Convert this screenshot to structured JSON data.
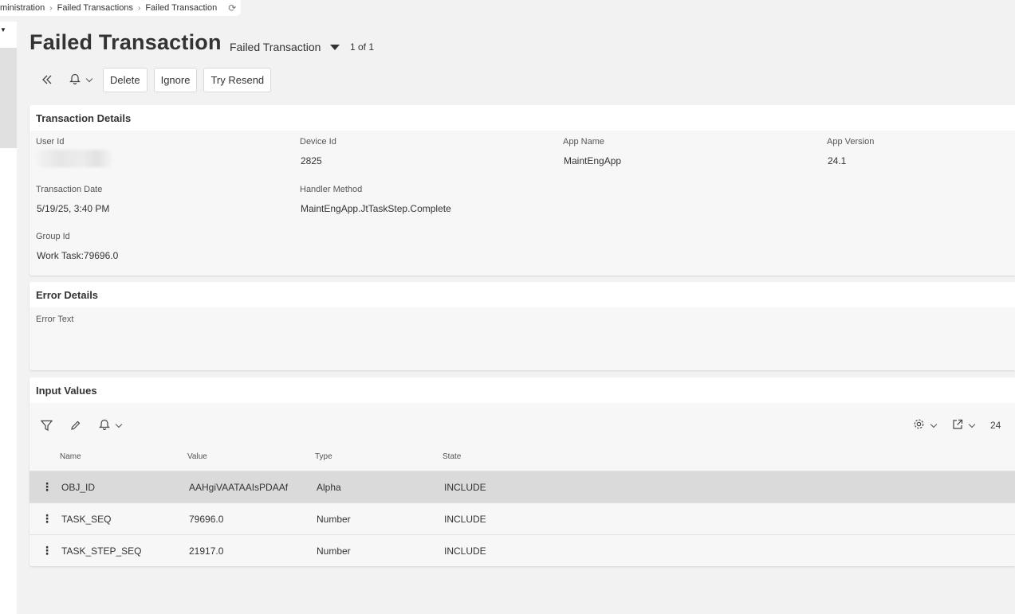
{
  "breadcrumb": {
    "items": [
      "ministration",
      "Failed Transactions",
      "Failed Transaction"
    ]
  },
  "header": {
    "title": "Failed Transaction",
    "record_selector": "Failed Transaction",
    "pager": "1 of 1"
  },
  "toolbar": {
    "delete_label": "Delete",
    "ignore_label": "Ignore",
    "resend_label": "Try Resend"
  },
  "transaction_details": {
    "title": "Transaction Details",
    "user_id_label": "User Id",
    "device_id_label": "Device Id",
    "device_id": "2825",
    "app_name_label": "App Name",
    "app_name": "MaintEngApp",
    "app_version_label": "App Version",
    "app_version": "24.1",
    "transaction_date_label": "Transaction Date",
    "transaction_date": "5/19/25, 3:40 PM",
    "handler_method_label": "Handler Method",
    "handler_method": "MaintEngApp.JtTaskStep.Complete",
    "group_id_label": "Group Id",
    "group_id": "Work Task:79696.0"
  },
  "error_details": {
    "title": "Error Details",
    "error_text_label": "Error Text",
    "error_text": ""
  },
  "input_values": {
    "title": "Input Values",
    "page_count_partial": "24",
    "columns": [
      "Name",
      "Value",
      "Type",
      "State"
    ],
    "rows": [
      {
        "name": "OBJ_ID",
        "value": "AAHgiVAATAAIsPDAAf",
        "type": "Alpha",
        "state": "INCLUDE"
      },
      {
        "name": "TASK_SEQ",
        "value": "79696.0",
        "type": "Number",
        "state": "INCLUDE"
      },
      {
        "name": "TASK_STEP_SEQ",
        "value": "21917.0",
        "type": "Number",
        "state": "INCLUDE"
      }
    ]
  },
  "icons": {
    "collapse": "double-chevron-left-icon",
    "bell": "bell-icon",
    "refresh": "refresh-icon",
    "filter": "filter-icon",
    "edit": "pencil-icon",
    "settings": "gear-icon",
    "export": "export-icon",
    "row_menu": "kebab-icon"
  },
  "colors": {
    "background": "#f2f2f2",
    "panel": "#f7f7f7",
    "selected_row": "#dadada"
  }
}
